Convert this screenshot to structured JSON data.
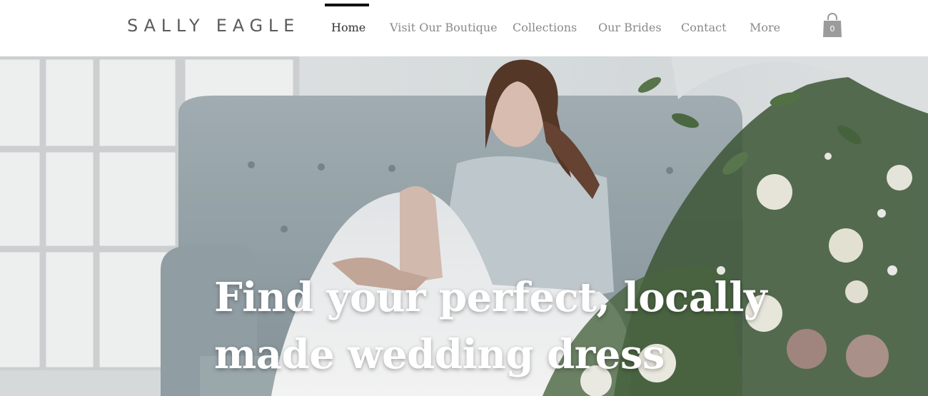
{
  "brand": {
    "name": "SALLY EAGLE"
  },
  "nav": {
    "items": [
      {
        "label": "Home",
        "active": true
      },
      {
        "label": "Visit Our Boutique",
        "active": false
      },
      {
        "label": "Collections",
        "active": false
      },
      {
        "label": "Our Brides",
        "active": false
      },
      {
        "label": "Contact",
        "active": false
      },
      {
        "label": "More",
        "active": false
      }
    ]
  },
  "cart": {
    "count": "0",
    "icon": "shopping-bag-icon"
  },
  "hero": {
    "headline_line1": "Find your perfect, locally",
    "headline_line2": "made wedding dress",
    "image": "bride-on-sofa-photo"
  },
  "colors": {
    "header_bg": "#ffffff",
    "logo": "#5b5b5b",
    "nav_text": "#8a8a8a",
    "nav_active_text": "#333333",
    "nav_active_bar": "#111111",
    "cart_icon": "#9b9b9b",
    "headline": "#ffffff"
  }
}
